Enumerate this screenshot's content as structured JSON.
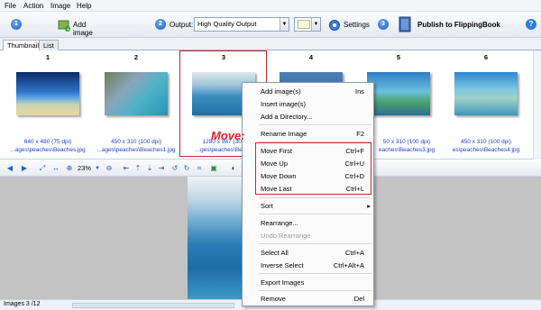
{
  "menubar": {
    "items": [
      "File",
      "Action",
      "Image",
      "Help"
    ]
  },
  "toolbar": {
    "step1": "1",
    "add_image": "Add image",
    "step2": "2",
    "output_label": "Output:",
    "output_value": "High Quality Output",
    "settings": "Settings",
    "step3": "3",
    "publish": "Publish to FlippingBook"
  },
  "tabs": [
    "Thumbnail",
    "List"
  ],
  "thumbnails": [
    {
      "num": "1",
      "dims": "640 x 480 (75 dpi)",
      "file": "...ages\\peaches\\Beaches.jpg"
    },
    {
      "num": "2",
      "dims": "450 x 310 (100 dpi)",
      "file": "...ages\\peaches\\Beaches1.jpg"
    },
    {
      "num": "3",
      "dims": "1280 x 987 (300",
      "file": "...ges\\peaches\\Beach"
    },
    {
      "num": "4",
      "dims": "",
      "file": ""
    },
    {
      "num": "5",
      "dims": "50 x 310 (100 dpi)",
      "file": "eaches\\Beaches3.jpg"
    },
    {
      "num": "6",
      "dims": "450 x 310 (100 dpi)",
      "file": "es\\peaches\\Beaches4.jpg"
    }
  ],
  "view_toolbar": {
    "zoom": "23%"
  },
  "annotation": "Move:",
  "context_menu": [
    {
      "label": "Add image(s)",
      "shortcut": "Ins"
    },
    {
      "label": "Insert image(s)",
      "shortcut": ""
    },
    {
      "label": "Add a Directory...",
      "shortcut": ""
    },
    {
      "label": "Rename Image",
      "shortcut": "F2"
    },
    {
      "label": "Move First",
      "shortcut": "Ctrl+F"
    },
    {
      "label": "Move Up",
      "shortcut": "Ctrl+U"
    },
    {
      "label": "Move Down",
      "shortcut": "Ctrl+D"
    },
    {
      "label": "Move Last",
      "shortcut": "Ctrl+L"
    },
    {
      "label": "Sort",
      "shortcut": "▸"
    },
    {
      "label": "Rearrange...",
      "shortcut": ""
    },
    {
      "label": "Undo Rearrange",
      "shortcut": ""
    },
    {
      "label": "Select All",
      "shortcut": "Ctrl+A"
    },
    {
      "label": "Inverse Select",
      "shortcut": "Ctrl+Alt+A"
    },
    {
      "label": "Export Images",
      "shortcut": ""
    },
    {
      "label": "Remove",
      "shortcut": "Del"
    }
  ],
  "status": {
    "text": "Images 3 /12"
  }
}
